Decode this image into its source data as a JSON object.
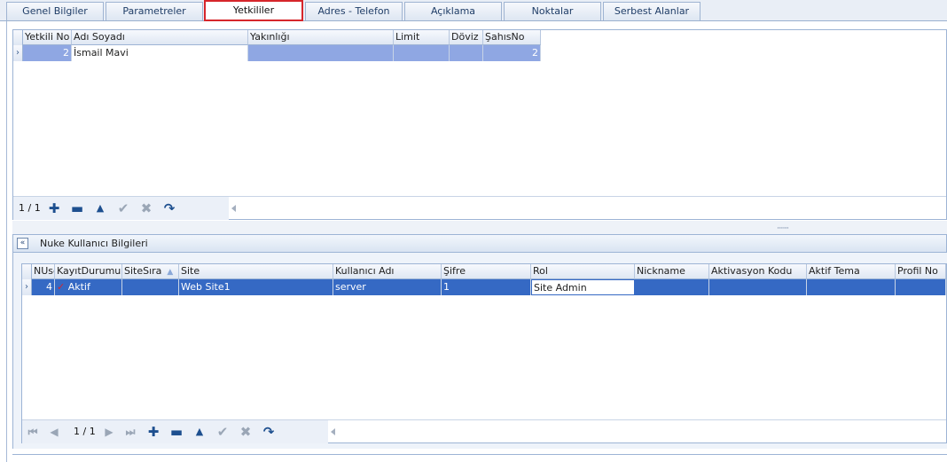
{
  "tabs": [
    {
      "label": "Genel Bilgiler"
    },
    {
      "label": "Parametreler"
    },
    {
      "label": "Yetkililer"
    },
    {
      "label": "Adres - Telefon"
    },
    {
      "label": "Açıklama"
    },
    {
      "label": "Noktalar"
    },
    {
      "label": "Serbest Alanlar"
    }
  ],
  "active_tab": "Yetkililer",
  "colors": {
    "active_tab_border": "#d6262b",
    "selection": "#3569c4",
    "selection_pale": "#8fa7e3",
    "border": "#9db4d5"
  },
  "yetkililer_grid": {
    "columns": [
      "Yetkili No",
      "Adı Soyadı",
      "Yakınlığı",
      "Limit",
      "Döviz",
      "ŞahısNo"
    ],
    "rows": [
      {
        "yetkili_no": "2",
        "adi_soyadi": "İsmail Mavi",
        "yakinligi": "",
        "limit": "",
        "doviz": "",
        "sahis_no": "2"
      }
    ],
    "record_counter": "1 / 1"
  },
  "group": {
    "title": "Nuke Kullanıcı Bilgileri"
  },
  "nuke_grid": {
    "columns": [
      "NUse",
      "KayıtDurumu",
      "SiteSıra",
      "Site",
      "Kullanıcı Adı",
      "Şifre",
      "Rol",
      "Nickname",
      "Aktivasyon Kodu",
      "Aktif Tema",
      "Profil No"
    ],
    "rows": [
      {
        "nuse": "4",
        "kayit_durumu": "Aktif",
        "site_sira": "",
        "site": "Web Site1",
        "kullanici_adi": "server",
        "sifre": "1",
        "rol": "Site Admin",
        "nickname": "",
        "aktivasyon_kodu": "",
        "aktif_tema": "",
        "profil_no": ""
      }
    ],
    "record_counter": "1 / 1",
    "sorted_column": "SiteSıra",
    "sort_direction": "ascending"
  },
  "icons": {
    "first": "first-record-icon",
    "prev": "prev-record-icon",
    "next": "next-record-icon",
    "last": "last-record-icon",
    "add": "add-icon",
    "delete": "minus-icon",
    "edit": "up-arrow-icon",
    "save": "checkmark-icon",
    "cancel": "x-icon",
    "refresh": "refresh-icon"
  }
}
